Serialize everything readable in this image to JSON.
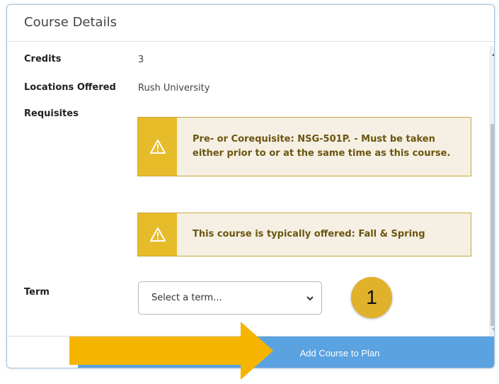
{
  "dialog": {
    "title": "Course Details"
  },
  "details": {
    "credits_label": "Credits",
    "credits_value": "3",
    "locations_label": "Locations Offered",
    "locations_value": "Rush University",
    "requisites_label": "Requisites",
    "term_label": "Term"
  },
  "alerts": [
    {
      "icon": "warning-icon",
      "line1": "Pre- or Corequisite: NSG-501P. - Must be taken",
      "line2": "either prior to or at the same time as this course."
    },
    {
      "icon": "warning-icon",
      "line1": "This course is typically offered: Fall & Spring"
    }
  ],
  "term_select": {
    "selected": "Select a term..."
  },
  "annotation": {
    "step": "1",
    "badge_color": "#e0b12b",
    "arrow_color": "#f5b400"
  },
  "footer": {
    "add_label": "Add Course to Plan",
    "button_color": "#5aa2e0"
  }
}
